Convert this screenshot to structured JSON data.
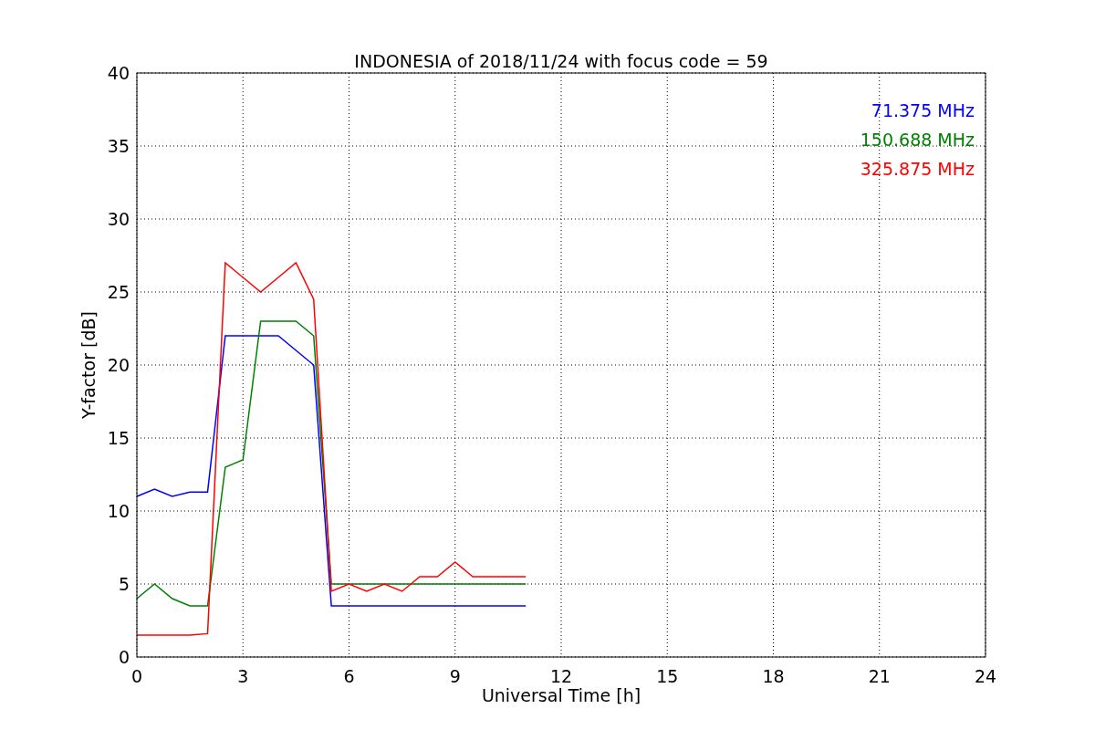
{
  "chart_data": {
    "type": "line",
    "title": "INDONESIA of 2018/11/24 with focus code = 59",
    "xlabel": "Universal Time [h]",
    "ylabel": "Y-factor [dB]",
    "x": [
      0,
      0.5,
      1,
      1.5,
      2,
      2.5,
      3,
      3.5,
      4,
      4.5,
      5,
      5.5,
      6,
      6.5,
      7,
      7.5,
      8,
      8.5,
      9,
      9.5,
      10,
      10.5,
      11
    ],
    "series": [
      {
        "name": "71.375 MHz",
        "color": "#0000ff",
        "values": [
          11,
          11.5,
          11,
          11.3,
          11.3,
          22,
          22,
          22,
          22,
          21,
          20,
          3.5,
          3.5,
          3.5,
          3.5,
          3.5,
          3.5,
          3.5,
          3.5,
          3.5,
          3.5,
          3.5,
          3.5
        ]
      },
      {
        "name": "150.688 MHz",
        "color": "#008000",
        "values": [
          4,
          5,
          4,
          3.5,
          3.5,
          13,
          13.5,
          23,
          23,
          23,
          22,
          5,
          5,
          5,
          5,
          5,
          5,
          5,
          5,
          5,
          5,
          5,
          5
        ]
      },
      {
        "name": "325.875 MHz",
        "color": "#ff0000",
        "values": [
          1.5,
          1.5,
          1.5,
          1.5,
          1.6,
          27,
          26,
          25,
          26,
          27,
          24.5,
          4.5,
          5,
          4.5,
          5,
          4.5,
          5.5,
          5.5,
          6.5,
          5.5,
          5.5,
          5.5,
          5.5
        ]
      }
    ],
    "xlim": [
      0,
      24
    ],
    "ylim": [
      0,
      40
    ],
    "xticks": [
      0,
      3,
      6,
      9,
      12,
      15,
      18,
      21,
      24
    ],
    "yticks": [
      0,
      5,
      10,
      15,
      20,
      25,
      30,
      35,
      40
    ],
    "grid": true
  }
}
